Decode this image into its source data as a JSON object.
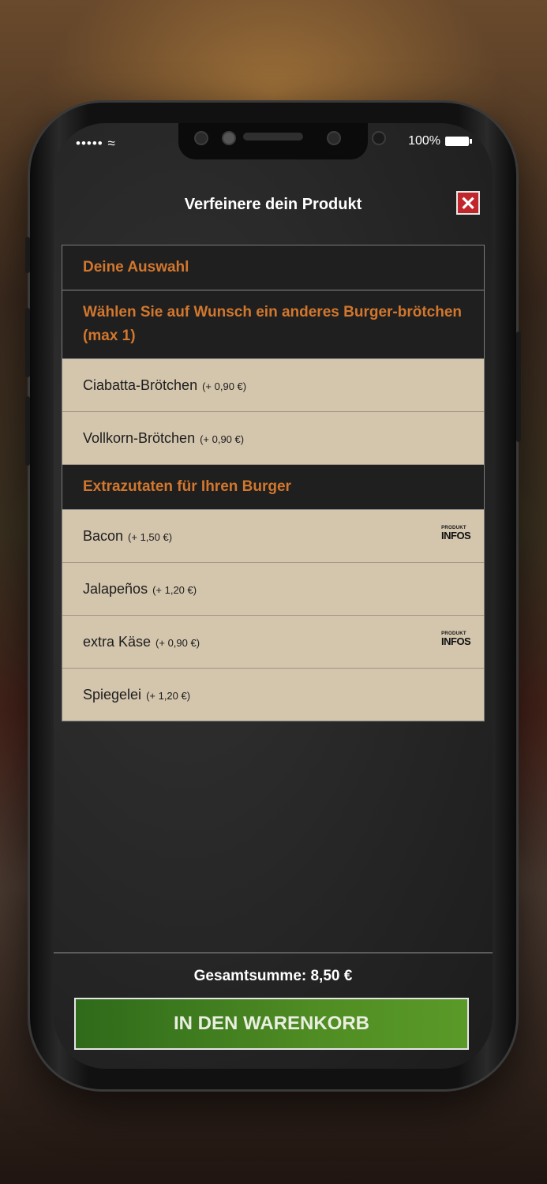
{
  "status": {
    "signal": "••••• ",
    "battery": "100%"
  },
  "modal": {
    "title": "Verfeinere dein Produkt",
    "close_label": "✕"
  },
  "sections": [
    {
      "title": "Deine Auswahl"
    },
    {
      "title": "Wählen Sie auf Wunsch ein anderes Burger-brötchen (max 1)"
    },
    {
      "title": "Extrazutaten für Ihren Burger"
    }
  ],
  "buns": [
    {
      "name": "Ciabatta-Brötchen",
      "price": "(+ 0,90 €)"
    },
    {
      "name": "Vollkorn-Brötchen",
      "price": "(+ 0,90 €)"
    }
  ],
  "extras": [
    {
      "name": "Bacon",
      "price": "(+ 1,50 €)",
      "info": true
    },
    {
      "name": "Jalapeños",
      "price": "(+ 1,20 €)",
      "info": false
    },
    {
      "name": "extra Käse",
      "price": "(+ 0,90 €)",
      "info": true
    },
    {
      "name": "Spiegelei",
      "price": "(+ 1,20 €)",
      "info": false
    }
  ],
  "info_badge": {
    "line1": "PRODUKT",
    "line2": "INFOS"
  },
  "footer": {
    "total": "Gesamtsumme: 8,50 €",
    "cart_button": "IN DEN WARENKORB"
  },
  "colors": {
    "accent": "#d2772d",
    "option_bg": "#d4c5ad",
    "cart_green": "#4f8c23",
    "close_red": "#c0262c"
  }
}
